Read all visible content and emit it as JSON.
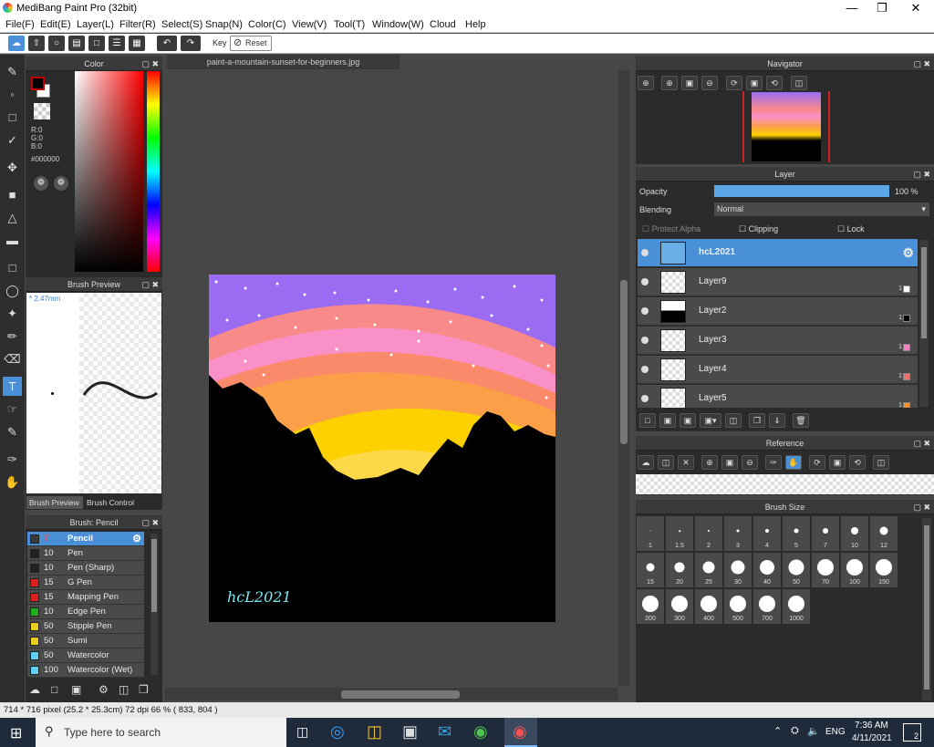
{
  "app": {
    "title": "MediBang Paint Pro (32bit)"
  },
  "menu": [
    "File(F)",
    "Edit(E)",
    "Layer(L)",
    "Filter(R)",
    "Select(S)",
    "Snap(N)",
    "Color(C)",
    "View(V)",
    "Tool(T)",
    "Window(W)",
    "Cloud",
    "Help"
  ],
  "toolbar": {
    "key_label": "Key",
    "reset_label": "Reset"
  },
  "color_panel": {
    "title": "Color",
    "r": "R:0",
    "g": "G:0",
    "b": "B:0",
    "hex": "#000000",
    "fg": "#c00000",
    "bg": "#ffffff"
  },
  "brush_preview": {
    "title": "Brush Preview",
    "size": "* 2.47mm",
    "tab1": "Brush Preview",
    "tab2": "Brush Control"
  },
  "brush_list": {
    "title": "Brush: Pencil",
    "items": [
      {
        "size": "7",
        "name": "Pencil",
        "color": "#3a3a3a"
      },
      {
        "size": "10",
        "name": "Pen",
        "color": "#222222"
      },
      {
        "size": "10",
        "name": "Pen (Sharp)",
        "color": "#222222"
      },
      {
        "size": "15",
        "name": "G Pen",
        "color": "#e02020"
      },
      {
        "size": "15",
        "name": "Mapping Pen",
        "color": "#e02020"
      },
      {
        "size": "10",
        "name": "Edge Pen",
        "color": "#20b020"
      },
      {
        "size": "50",
        "name": "Stipple Pen",
        "color": "#e8d020"
      },
      {
        "size": "50",
        "name": "Sumi",
        "color": "#e8d020"
      },
      {
        "size": "50",
        "name": "Watercolor",
        "color": "#60d0f0"
      },
      {
        "size": "100",
        "name": "Watercolor (Wet)",
        "color": "#60d0f0"
      }
    ]
  },
  "document": {
    "tab": "paint-a-mountain-sunset-for-beginners.jpg",
    "signature": "hcL2021"
  },
  "navigator": {
    "title": "Navigator"
  },
  "layer_panel": {
    "title": "Layer",
    "opacity_label": "Opacity",
    "opacity_value": "100 %",
    "opacity": 1.0,
    "blending_label": "Blending",
    "blending_value": "Normal",
    "protect_alpha": "Protect Alpha",
    "clipping": "Clipping",
    "lock": "Lock",
    "layers": [
      {
        "name": "hcL2021",
        "selected": true,
        "color": ""
      },
      {
        "name": "Layer9",
        "selected": false,
        "color": "#ffffff"
      },
      {
        "name": "Layer2",
        "selected": false,
        "color": "#000000"
      },
      {
        "name": "Layer3",
        "selected": false,
        "color": "#f080c0"
      },
      {
        "name": "Layer4",
        "selected": false,
        "color": "#f07070"
      },
      {
        "name": "Layer5",
        "selected": false,
        "color": "#f09030"
      }
    ]
  },
  "reference": {
    "title": "Reference"
  },
  "brush_size": {
    "title": "Brush Size",
    "sizes": [
      "1",
      "1.5",
      "2",
      "3",
      "4",
      "5",
      "7",
      "10",
      "12",
      "15",
      "20",
      "25",
      "30",
      "40",
      "50",
      "70",
      "100",
      "150",
      "200",
      "300",
      "400",
      "500",
      "700",
      "1000"
    ]
  },
  "status": {
    "text": "714 * 716 pixel  (25.2 * 25.3cm)  72 dpi  66 %  ( 833, 804 )"
  },
  "taskbar": {
    "search_placeholder": "Type here to search",
    "lang": "ENG",
    "time": "7:36 AM",
    "date": "4/11/2021",
    "notif": "2"
  }
}
